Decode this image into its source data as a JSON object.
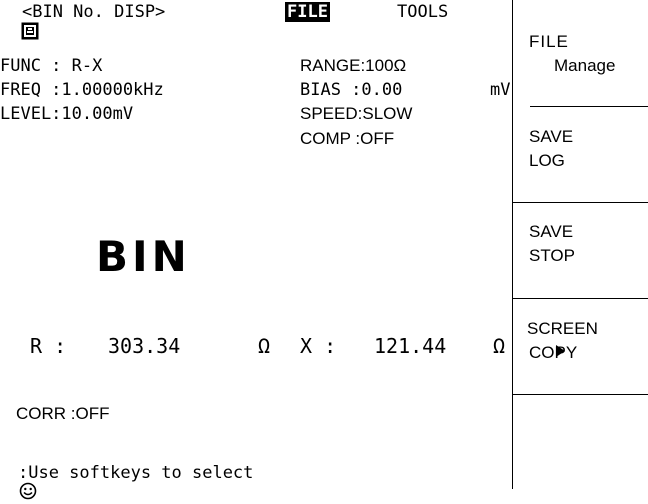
{
  "header": {
    "page_title": "<BIN No. DISP>",
    "menu_file": "FILE",
    "menu_tools": "TOOLS"
  },
  "params": {
    "func": "FUNC : R-X",
    "freq": "FREQ :1.00000kHz",
    "level": "LEVEL:10.00mV",
    "range": "RANGE:100Ω",
    "bias": "BIAS :0.00",
    "bias_unit": "mV",
    "speed": "SPEED:SLOW",
    "comp": "COMP :OFF"
  },
  "main": {
    "bin_label": "BIN",
    "r_label": "R :",
    "r_value": "303.34",
    "r_unit": "Ω",
    "x_label": "X :",
    "x_value": "121.44",
    "x_unit": "Ω",
    "corr": "CORR :OFF"
  },
  "status": {
    "icon": "smiley-icon",
    "message": ":Use softkeys to select"
  },
  "softkeys": [
    {
      "line1": "FILE",
      "line2": "Manage"
    },
    {
      "line1": "SAVE",
      "line2": "LOG"
    },
    {
      "line1": "SAVE",
      "line2": "STOP"
    },
    {
      "line1": "SCREEN",
      "line2": "COPY"
    }
  ]
}
